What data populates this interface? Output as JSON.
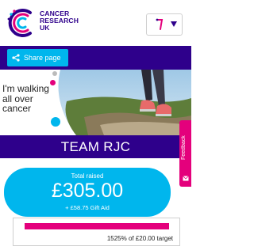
{
  "header": {
    "brand_lines": [
      "CANCER",
      "RESEARCH",
      "UK"
    ],
    "account_icon": "user-icon",
    "menu_icon": "chevron-down-icon"
  },
  "toolbar": {
    "share_label": "Share page",
    "share_icon": "share-icon"
  },
  "banner": {
    "tagline": "I'm walking all over cancer"
  },
  "team": {
    "name": "TEAM RJC"
  },
  "fundraising": {
    "total_label": "Total raised",
    "total_amount": "£305.00",
    "gift_aid": "+ £58.75 Gift Aid",
    "progress_text": "1525% of £20.00 target",
    "progress_fraction": 1.0
  },
  "feedback": {
    "label": "Feedback",
    "icon": "mail-icon"
  },
  "colors": {
    "brand_purple": "#2e008b",
    "accent_blue": "#00b6ed",
    "accent_pink": "#e4007c"
  }
}
